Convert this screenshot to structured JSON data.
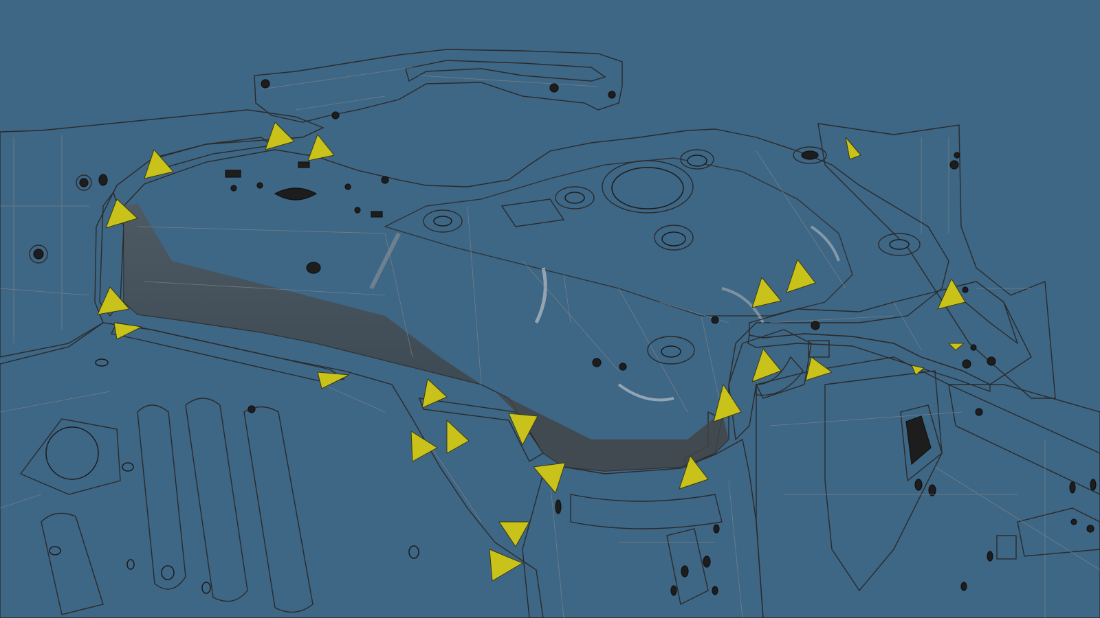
{
  "scene": {
    "background_color": "#3e6685",
    "light_part_color": "#c9c9c9",
    "dark_part_color": "#5a5a5a",
    "marker_color": "#c9c21a",
    "marker_icon": "weld-point-triangle-icon",
    "marker_count": 27
  }
}
